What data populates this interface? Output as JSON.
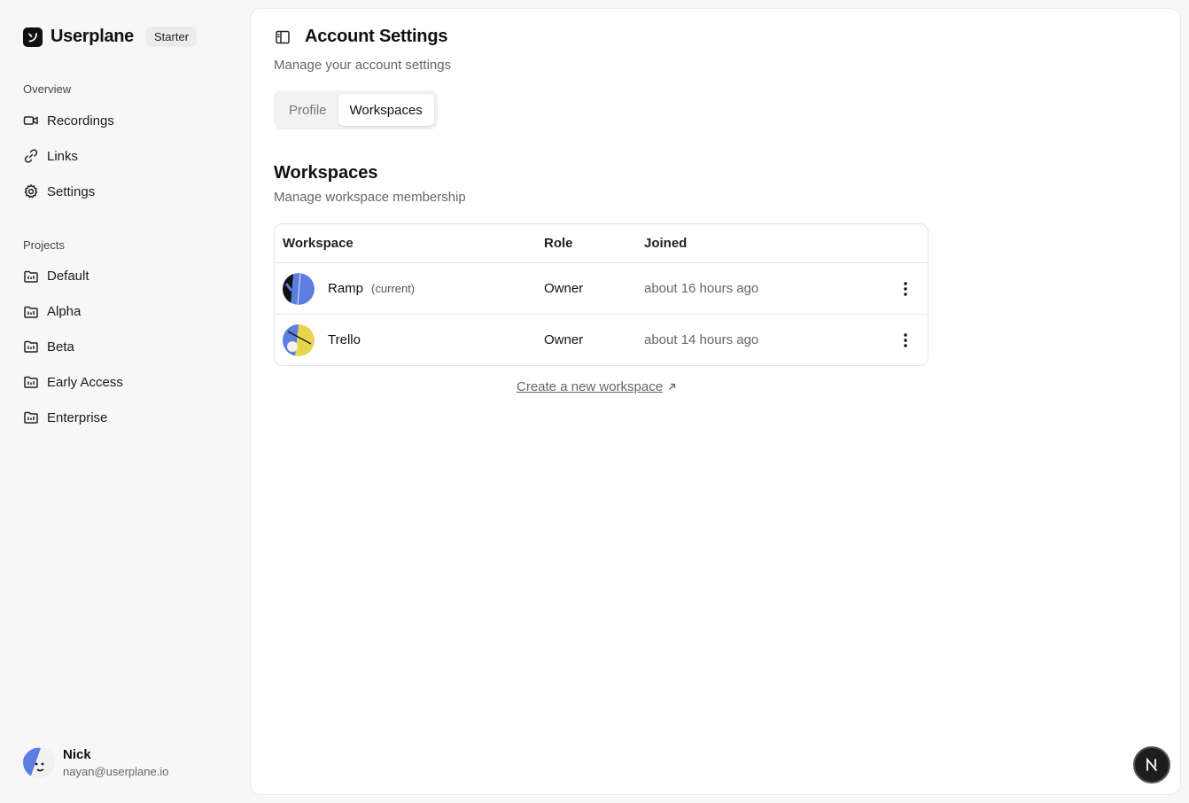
{
  "brand": {
    "name": "Userplane",
    "plan": "Starter"
  },
  "sidebar": {
    "overview_label": "Overview",
    "overview_items": [
      {
        "label": "Recordings",
        "icon": "video-icon"
      },
      {
        "label": "Links",
        "icon": "link-icon"
      },
      {
        "label": "Settings",
        "icon": "gear-icon"
      }
    ],
    "projects_label": "Projects",
    "projects": [
      {
        "label": "Default",
        "icon": "folder-icon"
      },
      {
        "label": "Alpha",
        "icon": "folder-icon"
      },
      {
        "label": "Beta",
        "icon": "folder-icon"
      },
      {
        "label": "Early Access",
        "icon": "folder-icon"
      },
      {
        "label": "Enterprise",
        "icon": "folder-icon"
      }
    ]
  },
  "user": {
    "name": "Nick",
    "email": "nayan@userplane.io"
  },
  "header": {
    "title": "Account Settings",
    "subtitle": "Manage your account settings"
  },
  "tabs": [
    {
      "label": "Profile",
      "active": false
    },
    {
      "label": "Workspaces",
      "active": true
    }
  ],
  "section": {
    "title": "Workspaces",
    "subtitle": "Manage workspace membership"
  },
  "table": {
    "columns": [
      "Workspace",
      "Role",
      "Joined"
    ],
    "rows": [
      {
        "name": "Ramp",
        "tag": "(current)",
        "role": "Owner",
        "joined": "about 16 hours ago"
      },
      {
        "name": "Trello",
        "tag": "",
        "role": "Owner",
        "joined": "about 14 hours ago"
      }
    ]
  },
  "create_link": "Create a new workspace",
  "badge": "N",
  "colors": {
    "accent_blue": "#5b7ee0",
    "accent_yellow": "#e8d44d",
    "dark": "#111111"
  }
}
